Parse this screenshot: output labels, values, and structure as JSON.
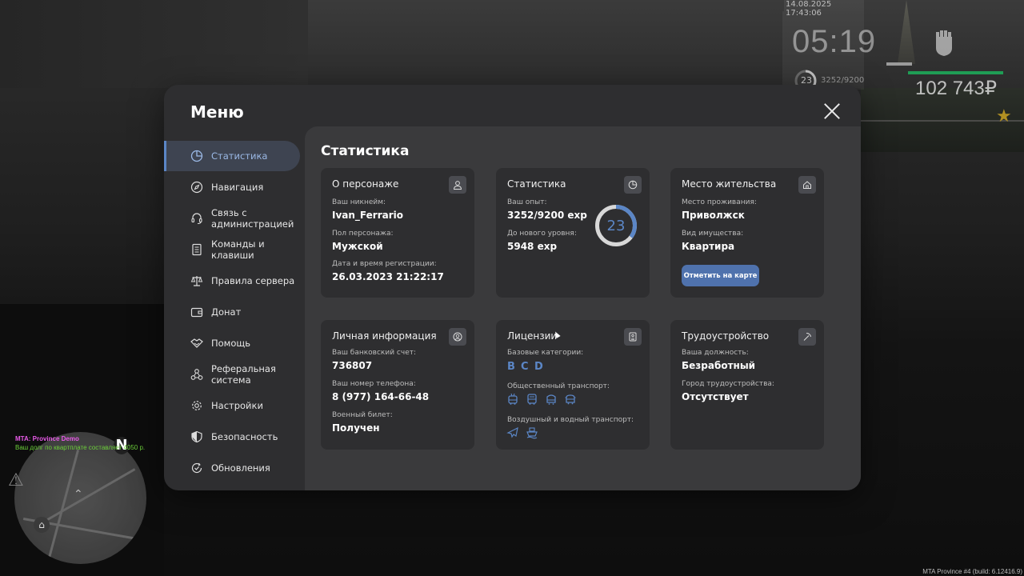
{
  "hud": {
    "datetime": "14.08.2025 17:43:06",
    "time": "05:19",
    "level": "23",
    "exp": "3252/9200",
    "money": "102 743₽"
  },
  "chat": {
    "line1": "MTA: Province Demo",
    "line2": "Ваш долг по квартплате составляет 4050 р."
  },
  "minimap": {
    "north": "N"
  },
  "build_info": "MTA Province #4 (build: 6.12416.9)",
  "menu": {
    "title": "Меню",
    "sidebar": [
      {
        "label": "Статистика",
        "icon": "pie-chart-icon",
        "active": true
      },
      {
        "label": "Навигация",
        "icon": "compass-icon",
        "active": false
      },
      {
        "label": "Связь с\nадминистрацией",
        "icon": "headset-icon",
        "active": false
      },
      {
        "label": "Команды и\nклавиши",
        "icon": "document-icon",
        "active": false
      },
      {
        "label": "Правила сервера",
        "icon": "scales-icon",
        "active": false
      },
      {
        "label": "Донат",
        "icon": "wallet-icon",
        "active": false
      },
      {
        "label": "Помощь",
        "icon": "handshake-icon",
        "active": false
      },
      {
        "label": "Реферальная\nсистема",
        "icon": "network-icon",
        "active": false
      },
      {
        "label": "Настройки",
        "icon": "gear-icon",
        "active": false
      },
      {
        "label": "Безопасность",
        "icon": "shield-icon",
        "active": false
      },
      {
        "label": "Обновления",
        "icon": "refresh-check-icon",
        "active": false
      }
    ],
    "content_title": "Статистика",
    "cards": {
      "character": {
        "title": "О персонаже",
        "nick_label": "Ваш никнейм:",
        "nick": "Ivan_Ferrario",
        "gender_label": "Пол персонажа:",
        "gender": "Мужской",
        "reg_label": "Дата и время регистрации:",
        "reg": "26.03.2023 21:22:17"
      },
      "stats": {
        "title": "Статистика",
        "exp_label": "Ваш опыт:",
        "exp": "3252/9200 exp",
        "next_label": "До нового уровня:",
        "next": "5948 exp",
        "level": "23",
        "progress": 0.3535
      },
      "residence": {
        "title": "Место жительства",
        "place_label": "Место проживания:",
        "place": "Приволжск",
        "property_label": "Вид имущества:",
        "property": "Квартира",
        "button": "Отметить на карте"
      },
      "personal": {
        "title": "Личная информация",
        "bank_label": "Ваш банковский счет:",
        "bank": "736807",
        "phone_label": "Ваш номер телефона:",
        "phone": "8 (977) 164-66-48",
        "military_label": "Военный билет:",
        "military": "Получен"
      },
      "licenses": {
        "title": "Лицензии",
        "base_label": "Базовые категории:",
        "categories": [
          "B",
          "C",
          "D"
        ],
        "public_label": "Общественный транспорт:",
        "public_icons": [
          "trolleybus-icon",
          "bus-icon",
          "tram-icon",
          "minibus-icon"
        ],
        "air_water_label": "Воздушный и водный транспорт:",
        "air_water_icons": [
          "plane-icon",
          "ship-icon"
        ]
      },
      "employment": {
        "title": "Трудоустройство",
        "position_label": "Ваша должность:",
        "position": "Безработный",
        "city_label": "Город трудоустройства:",
        "city": "Отсутствует"
      }
    }
  },
  "colors": {
    "accent": "#5b86c6",
    "button": "#4f72ad",
    "window": "#2e2e30",
    "content": "#3a3a3c",
    "card": "#2e2e30"
  }
}
